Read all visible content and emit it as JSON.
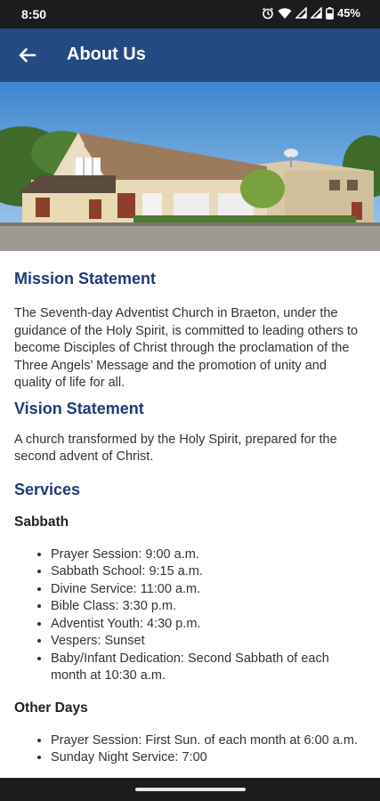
{
  "status_bar": {
    "time": "8:50",
    "battery": "45%",
    "icons": [
      "alarm-icon",
      "wifi-icon",
      "signal-icon",
      "signal-icon",
      "battery-icon"
    ]
  },
  "app_bar": {
    "title": "About Us",
    "back_icon": "arrow-left-icon"
  },
  "hero_image": {
    "description_icon": "church-building-photo"
  },
  "mission": {
    "heading": "Mission Statement",
    "text": "The Seventh-day Adventist Church in Braeton, under the guidance of the Holy Spirit, is committed to leading others to become Disciples of Christ through the proclamation of the Three Angels’ Message and the promotion of unity and quality of life for all."
  },
  "vision": {
    "heading": "Vision Statement",
    "text": "A church transformed by the Holy Spirit, prepared for the second advent of Christ."
  },
  "services": {
    "heading": "Services",
    "sabbath": {
      "title": "Sabbath",
      "items": [
        "Prayer Session: 9:00 a.m.",
        "Sabbath School: 9:15 a.m.",
        "Divine Service: 11:00 a.m.",
        "Bible Class: 3:30 p.m.",
        "Adventist Youth: 4:30 p.m.",
        "Vespers: Sunset",
        "Baby/Infant Dedication: Second Sabbath of each month at 10:30 a.m."
      ]
    },
    "other_days": {
      "title": "Other Days",
      "items": [
        "Prayer Session: First Sun. of each month at 6:00 a.m.",
        "Sunday Night Service: 7:00"
      ]
    }
  },
  "colors": {
    "app_bar": "#254a83",
    "heading": "#1e3a7a",
    "status_bar": "#1c1c1c"
  }
}
